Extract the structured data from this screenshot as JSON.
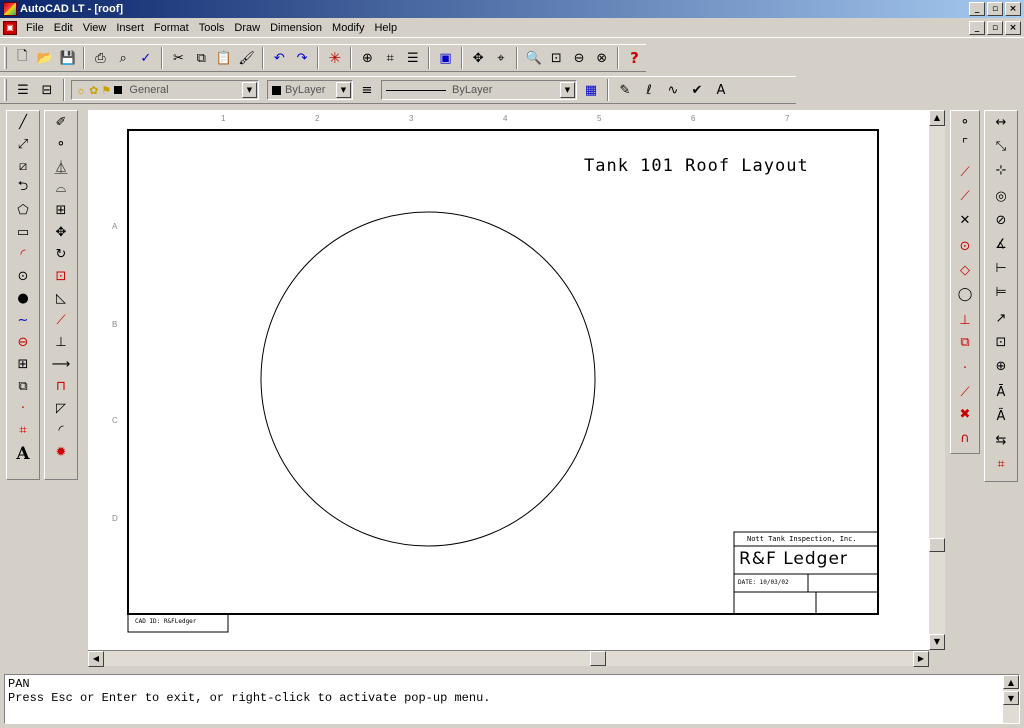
{
  "window": {
    "title": "AutoCAD LT - [roof]",
    "buttons": [
      "_",
      "▫",
      "×"
    ]
  },
  "menu": {
    "items": [
      "File",
      "Edit",
      "View",
      "Insert",
      "Format",
      "Tools",
      "Draw",
      "Dimension",
      "Modify",
      "Help"
    ]
  },
  "properties_toolbar": {
    "layer_name": "General",
    "color": "ByLayer",
    "linetype": "ByLayer"
  },
  "drawing": {
    "title": "Tank 101 Roof Layout",
    "ruler_top": [
      "1",
      "2",
      "3",
      "4",
      "5",
      "6",
      "7"
    ],
    "ruler_left": [
      "A",
      "B",
      "C",
      "D"
    ],
    "title_block": {
      "company": "Nott Tank Inspection, Inc.",
      "client": "R&F Ledger",
      "date": "DATE: 10/03/02"
    },
    "cad_id": "CAD ID: R&FLedger"
  },
  "command_line": {
    "lines": [
      "PAN",
      "Press Esc or Enter to exit, or right-click to activate pop-up menu."
    ]
  },
  "icons": {
    "standard": [
      "new-icon",
      "open-icon",
      "save-icon",
      "print-icon",
      "preview-icon",
      "spell-icon",
      "cut-icon",
      "copy-icon",
      "paste-icon",
      "match-properties-icon",
      "undo-icon",
      "redo-icon",
      "snap-icon",
      "object-snap-icon",
      "tracking-icon",
      "ucs-icon",
      "aerial-icon",
      "pan-icon",
      "zoom-realtime-icon",
      "zoom-window-icon",
      "zoom-previous-icon",
      "zoom-extents-icon",
      "help-icon"
    ]
  }
}
